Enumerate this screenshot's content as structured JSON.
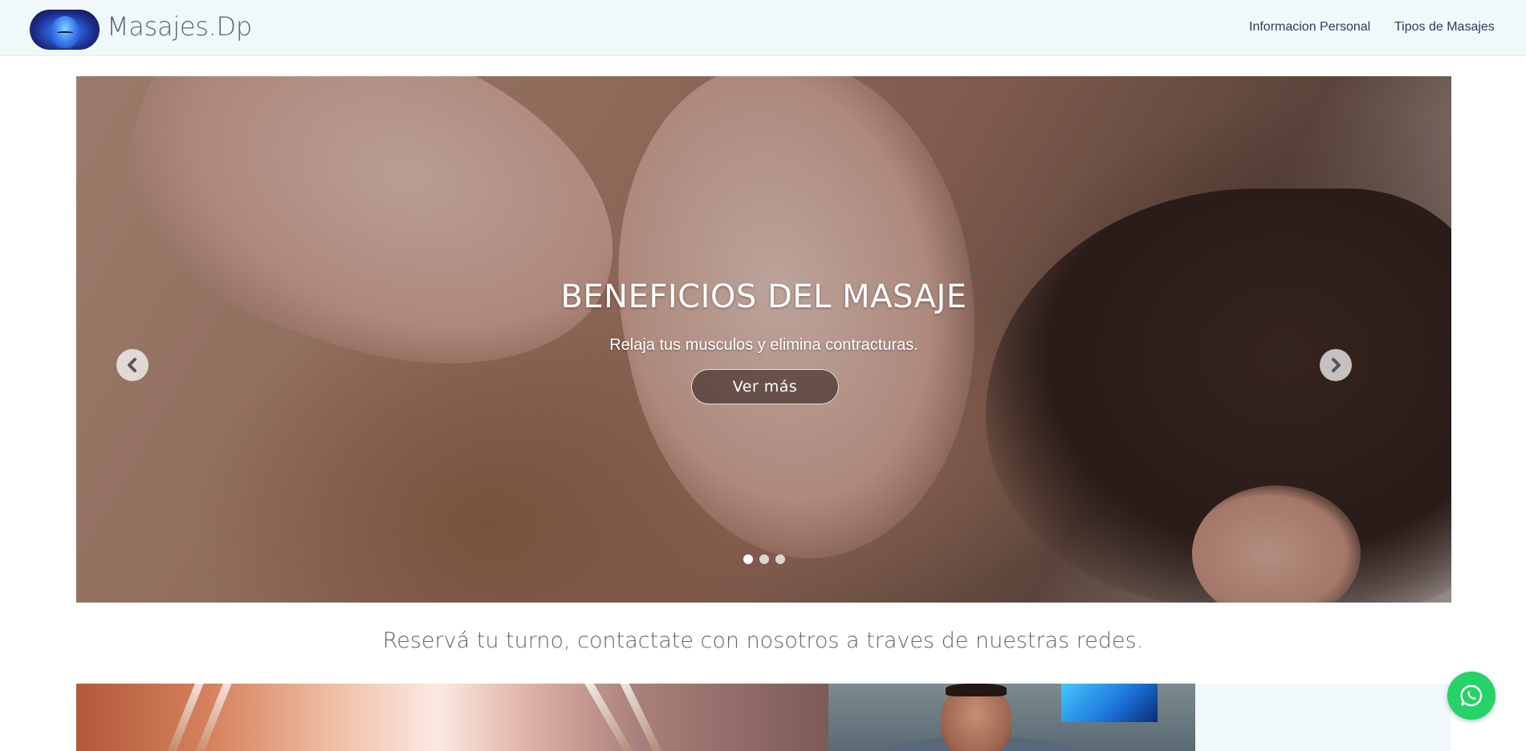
{
  "navbar": {
    "brand": "Masajes.Dp",
    "links": [
      {
        "label": "Informacion Personal"
      },
      {
        "label": "Tipos de Masajes"
      }
    ]
  },
  "carousel": {
    "title": "BENEFICIOS DEL MASAJE",
    "text": "Relaja tus musculos y elimina contracturas.",
    "button_label": "Ver más",
    "slides_count": 3,
    "active_slide": 1,
    "prev_icon": "chevron-left-icon",
    "next_icon": "chevron-right-icon"
  },
  "tagline": "Reservá tu turno, contactate con nosotros a traves de nuestras redes.",
  "floating": {
    "icon": "whatsapp-icon",
    "color": "#25d366"
  },
  "colors": {
    "navbar_bg": "#f1f8fa",
    "nav_link": "#2e3a64",
    "tagline": "#5d6674"
  }
}
